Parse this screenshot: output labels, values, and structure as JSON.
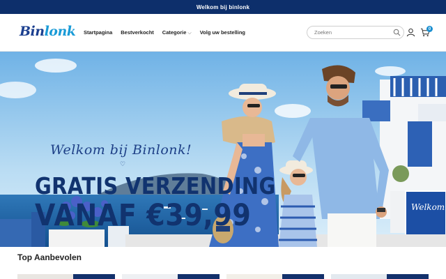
{
  "announcement": "Welkom bij binlonk",
  "logo": {
    "text_a": "Bin",
    "text_b": "lonk"
  },
  "nav": {
    "items": [
      "Startpagina",
      "Bestverkocht",
      "Categorie",
      "Volg uw bestelling"
    ],
    "dropdown_chevron": "⌵"
  },
  "search": {
    "placeholder": "Zoeken"
  },
  "cart": {
    "count": "0"
  },
  "icons": {
    "search": "search-icon",
    "user": "user-icon",
    "cart": "cart-icon"
  },
  "hero": {
    "script_title": "Welkom bij Binlonk!",
    "heart": "♡",
    "line1": "GRATIS VERZENDING",
    "line2": "VANAF €39,99",
    "sign_text": "Welkom"
  },
  "section": {
    "title": "Top Aanbevolen"
  },
  "colors": {
    "brand_navy": "#0d2f6b",
    "accent_blue": "#1a8fd0",
    "headline": "#11336f"
  }
}
